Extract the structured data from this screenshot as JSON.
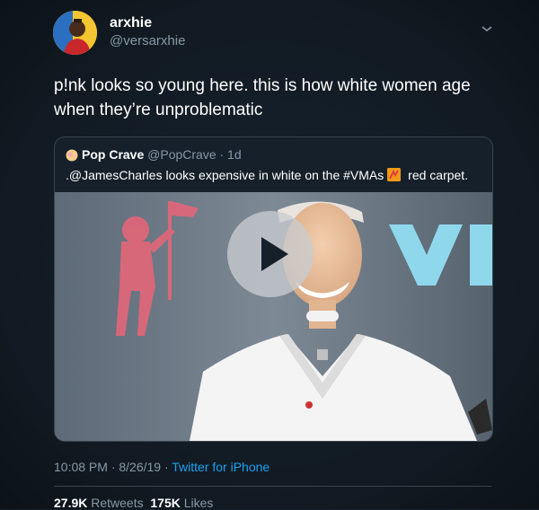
{
  "tweet": {
    "display_name": "arxhie",
    "handle": "@versarxhie",
    "text": "p!nk looks so young here. this is how white women age when they’re unproblematic",
    "timestamp": "10:08 PM · 8/26/19 · ",
    "source": "Twitter for iPhone",
    "retweets_count": "27.9K",
    "retweets_label": "Retweets",
    "likes_count": "175K",
    "likes_label": "Likes",
    "menu_icon": "chevron-down-icon"
  },
  "quoted_tweet": {
    "display_name": "Pop Crave",
    "handle": "@PopCrave · 1d",
    "text_before": ".@JamesCharles looks expensive in white on the #VMAs",
    "text_after": " red carpet.",
    "media_icon": "play-icon"
  },
  "colors": {
    "background": "#15202b",
    "secondary_text": "#8899a6",
    "link": "#1da1f2",
    "border": "#38444d"
  }
}
